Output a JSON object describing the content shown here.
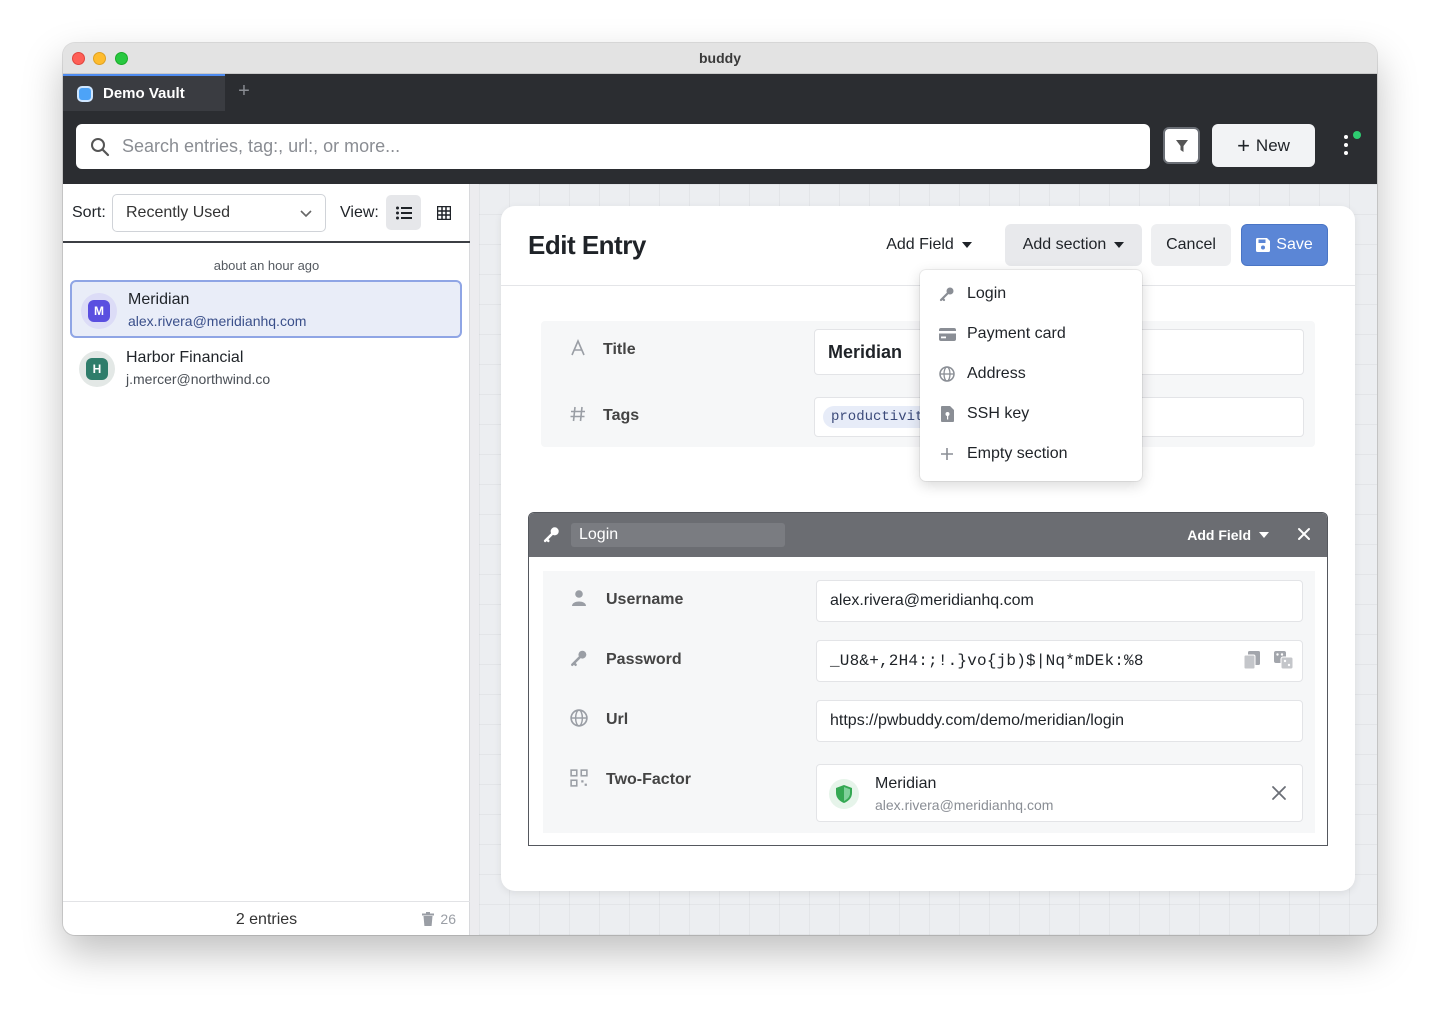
{
  "window": {
    "title": "buddy"
  },
  "tabs": [
    {
      "label": "Demo Vault"
    }
  ],
  "toolbar": {
    "search_placeholder": "Search entries, tag:, url:, or more...",
    "new_label": "New"
  },
  "sidebar": {
    "sort_label": "Sort:",
    "sort_value": "Recently Used",
    "view_label": "View:",
    "group_label": "about an hour ago",
    "entries": [
      {
        "initial": "M",
        "name": "Meridian",
        "sub": "alex.rivera@meridianhq.com",
        "color": "#5a4fe0"
      },
      {
        "initial": "H",
        "name": "Harbor Financial",
        "sub": "j.mercer@northwind.co",
        "color": "#2f7d6b"
      }
    ],
    "footer_count": "2 entries",
    "trash_count": "26"
  },
  "editor": {
    "title": "Edit Entry",
    "add_field_label": "Add Field",
    "add_section_label": "Add section",
    "cancel_label": "Cancel",
    "save_label": "Save",
    "fields": {
      "title_label": "Title",
      "title_value": "Meridian",
      "tags_label": "Tags",
      "tag_value": "productivity"
    },
    "section_menu": [
      {
        "label": "Login",
        "icon": "key-icon"
      },
      {
        "label": "Payment card",
        "icon": "card-icon"
      },
      {
        "label": "Address",
        "icon": "globe-icon"
      },
      {
        "label": "SSH key",
        "icon": "file-key-icon"
      },
      {
        "label": "Empty section",
        "icon": "plus-icon"
      }
    ],
    "login_section": {
      "title": "Login",
      "add_field_label": "Add Field",
      "username_label": "Username",
      "username_value": "alex.rivera@meridianhq.com",
      "password_label": "Password",
      "password_value": "_U8&+,2H4:;!.}vo{jb)$|Nq*mDEk:%8",
      "url_label": "Url",
      "url_value": "https://pwbuddy.com/demo/meridian/login",
      "twofactor_label": "Two-Factor",
      "twofactor_name": "Meridian",
      "twofactor_sub": "alex.rivera@meridianhq.com"
    }
  },
  "colors": {
    "accent": "#5b86d6",
    "selected_bg": "#e9edf8",
    "status_online": "#2ecc71"
  }
}
